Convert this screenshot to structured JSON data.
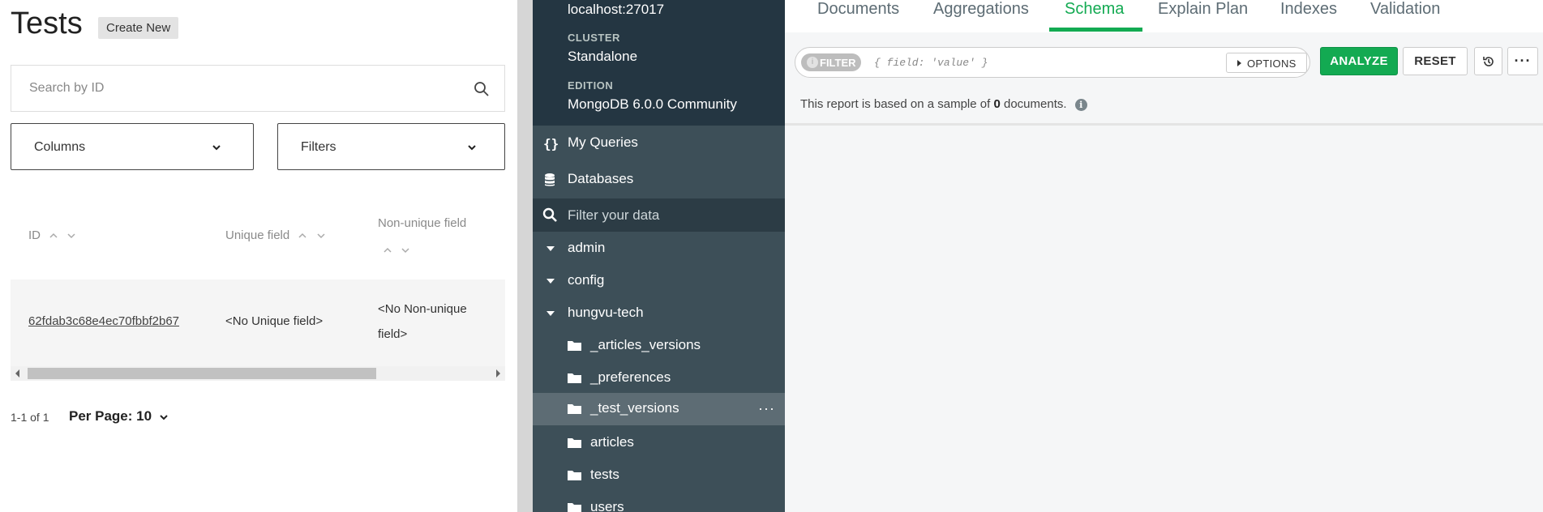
{
  "left": {
    "title": "Tests",
    "create_new": "Create New",
    "search_placeholder": "Search by ID",
    "columns_label": "Columns",
    "filters_label": "Filters",
    "table": {
      "headers": [
        "ID",
        "Unique field",
        "Non-unique field"
      ],
      "rows": [
        {
          "id": "62fdab3c68e4ec70fbbf2b67",
          "unique": "<No Unique field>",
          "non_unique_line1": "<No Non-unique",
          "non_unique_line2": "field>"
        }
      ]
    },
    "pagination": "1-1 of 1",
    "per_page": "Per Page: 10"
  },
  "sidebar": {
    "host": "localhost:27017",
    "cluster_caption": "CLUSTER",
    "cluster_value": "Standalone",
    "edition_caption": "EDITION",
    "edition_value": "MongoDB 6.0.0 Community",
    "my_queries": "My Queries",
    "databases": "Databases",
    "filter_placeholder": "Filter your data",
    "dbs": [
      "admin",
      "config",
      "hungvu-tech"
    ],
    "collections": [
      "_articles_versions",
      "_preferences",
      "_test_versions",
      "articles",
      "tests",
      "users"
    ],
    "active_collection": "_test_versions",
    "more": "···"
  },
  "main": {
    "tabs": [
      "Documents",
      "Aggregations",
      "Schema",
      "Explain Plan",
      "Indexes",
      "Validation"
    ],
    "active_tab": "Schema",
    "filter_label": "FILTER",
    "filter_info": "i",
    "query_placeholder": "{ field: 'value' }",
    "options_label": "OPTIONS",
    "analyze_label": "ANALYZE",
    "reset_label": "RESET",
    "more_label": "···",
    "report_prefix": "This report is based on a sample of",
    "report_count": "0",
    "report_suffix": "documents.",
    "info_glyph": "i"
  },
  "colors": {
    "accent_green": "#13aa52",
    "sidebar_bg": "#3d4f58",
    "sidebar_top_bg": "#243642"
  }
}
